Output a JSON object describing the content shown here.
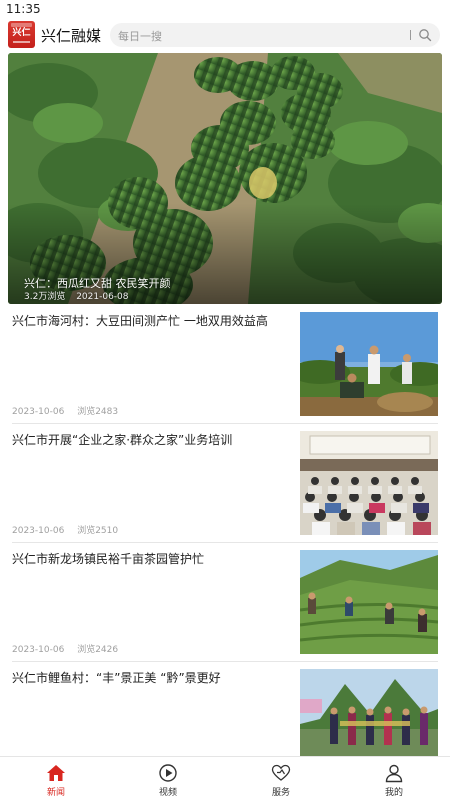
{
  "status_bar": {
    "time": "11:35"
  },
  "header": {
    "logo_text": "兴仁",
    "app_title": "兴仁融媒",
    "search_placeholder": "每日一搜"
  },
  "hero": {
    "caption": "兴仁：西瓜红又甜 农民笑开颜",
    "views": "3.2万浏览",
    "date": "2021-06-08"
  },
  "news": [
    {
      "title": "兴仁市海河村：大豆田间测产忙 一地双用效益高",
      "date": "2023-10-06",
      "views": "浏览2483",
      "thumb": "field-harvest"
    },
    {
      "title": "兴仁市开展“企业之家·群众之家”业务培训",
      "date": "2023-10-06",
      "views": "浏览2510",
      "thumb": "meeting-room"
    },
    {
      "title": "兴仁市新龙场镇民裕千亩茶园管护忙",
      "date": "2023-10-06",
      "views": "浏览2426",
      "thumb": "tea-garden"
    },
    {
      "title": "兴仁市鲤鱼村：“丰”景正美 “黔”景更好",
      "date": "",
      "views": "",
      "thumb": "festival"
    }
  ],
  "tabs": [
    {
      "label": "新闻",
      "icon": "home-icon",
      "active": true
    },
    {
      "label": "视频",
      "icon": "play-icon",
      "active": false
    },
    {
      "label": "服务",
      "icon": "heart-icon",
      "active": false
    },
    {
      "label": "我的",
      "icon": "user-icon",
      "active": false
    }
  ],
  "colors": {
    "accent": "#d8261f",
    "muted": "#a0a0a0"
  }
}
